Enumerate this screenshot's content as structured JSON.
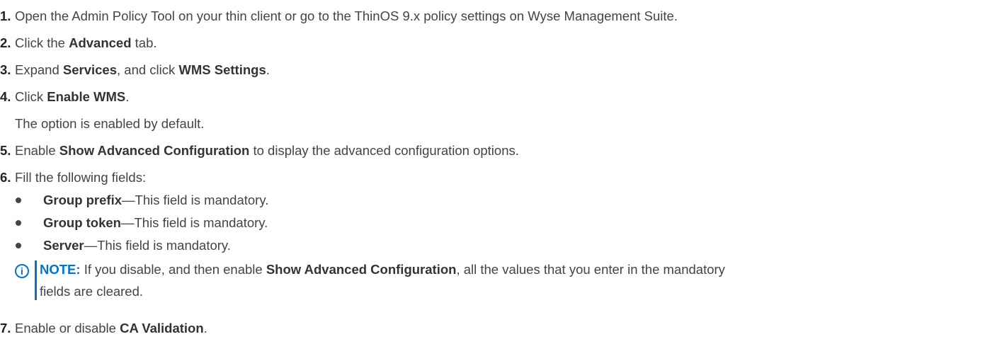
{
  "steps": [
    {
      "num": "1.",
      "parts": [
        "Open the Admin Policy Tool on your thin client or go to the ThinOS 9.x policy settings on Wyse Management Suite."
      ]
    },
    {
      "num": "2.",
      "parts": [
        "Click the ",
        "Advanced",
        " tab."
      ]
    },
    {
      "num": "3.",
      "parts": [
        "Expand ",
        "Services",
        ", and click ",
        "WMS Settings",
        "."
      ]
    },
    {
      "num": "4.",
      "parts": [
        "Click ",
        "Enable WMS",
        "."
      ],
      "sub": "The option is enabled by default."
    },
    {
      "num": "5.",
      "parts": [
        "Enable ",
        "Show Advanced Configuration",
        " to display the advanced configuration options."
      ]
    },
    {
      "num": "6.",
      "parts": [
        "Fill the following fields:"
      ]
    },
    {
      "num": "7.",
      "parts": [
        "Enable or disable ",
        "CA Validation",
        "."
      ]
    }
  ],
  "bullets": [
    {
      "term": "Group prefix",
      "desc": "—This field is mandatory."
    },
    {
      "term": "Group token",
      "desc": "—This field is mandatory."
    },
    {
      "term": "Server",
      "desc": "—This field is mandatory."
    }
  ],
  "note": {
    "icon": "info-icon",
    "icon_glyph": "i",
    "label": "NOTE:",
    "line1_a": " If you disable, and then enable ",
    "line1_b": "Show Advanced Configuration",
    "line1_c": ", all the values that you enter in the mandatory",
    "line2": "fields are cleared."
  },
  "colors": {
    "accent": "#0672cb",
    "text": "#444444"
  }
}
